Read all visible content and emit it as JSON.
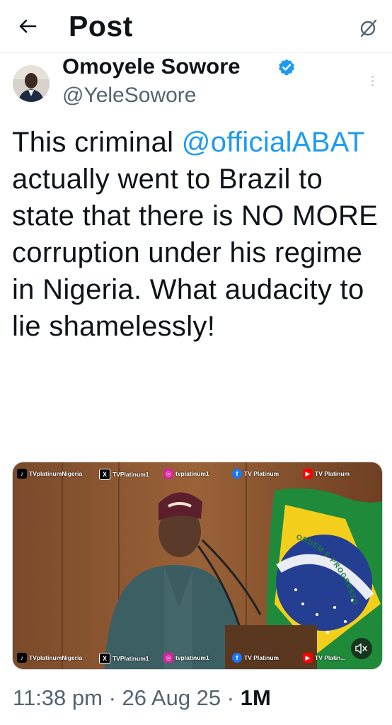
{
  "header": {
    "title": "Post",
    "back_icon": "back-arrow-icon",
    "grok_icon": "grok-icon"
  },
  "author": {
    "display_name": "Omoyele Sowore",
    "handle": "@YeleSowore",
    "verified": true,
    "verified_color": "#1d9bf0"
  },
  "tweet": {
    "text_before": "This criminal ",
    "mention": "@officialABAT",
    "text_after": " actually went to Brazil to state that there is NO MORE corruption under his regime in Nigeria. What audacity to lie shamelessly!"
  },
  "media": {
    "type": "video",
    "watermarks_top": {
      "tiktok": "TVplatinumNigeria",
      "x": "TVPlatinum1",
      "instagram": "tvplatinum1",
      "facebook": "TV Platinum",
      "youtube": "TV Platinum"
    },
    "watermarks_bottom": {
      "tiktok": "TVplatinumNigeria",
      "x": "TVPlatinum1",
      "instagram": "tvplatinum1",
      "facebook": "TV Platinum",
      "youtube": "TV Platin..."
    },
    "flag_text": "ORDEM E PROGRESSO",
    "mute_icon": "muted-speaker-icon"
  },
  "meta": {
    "time": "11:38 pm",
    "sep1": " · ",
    "date": "26 Aug 25",
    "sep2": " · ",
    "views": "1M"
  },
  "colors": {
    "accent": "#1d9bf0",
    "text_secondary": "#536471"
  }
}
